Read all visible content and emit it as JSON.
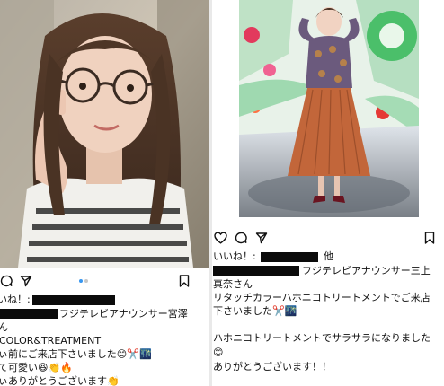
{
  "left_post": {
    "likes_prefix": "いね！:",
    "caption_line1": "フジテレビアナウンサー宮澤",
    "caption_line2": "ん",
    "caption_line3": "COLOR&TREATMENT",
    "caption_line4": "ぃ前にご来店下さいました😊✂️🌃",
    "caption_line5": "て可愛い😆👏🔥",
    "caption_line6": "ぃありがとうございます👏"
  },
  "right_post": {
    "likes_prefix": "いいね！:",
    "likes_suffix": "他",
    "caption_line1": "フジテレビアナウンサー三上",
    "caption_line2": "真奈さん",
    "caption_line3": "リタッチカラーハホニコトリートメントでご来店",
    "caption_line4": "下さいました✂️🌃",
    "caption_line5": "ハホニコトリートメントでサラサラになりました",
    "caption_line6": "😊",
    "caption_line7": "ありがとうございます！！"
  },
  "colors": {
    "like_active": "#111111",
    "carousel_dot_active": "#3897f0",
    "carousel_dot_inactive": "#c7c7c7",
    "redaction": "#0b0b0b"
  },
  "icons": {
    "left": [
      "comment-icon",
      "share-icon",
      "bookmark-icon"
    ],
    "right": [
      "heart-icon",
      "comment-icon",
      "share-icon",
      "bookmark-icon"
    ]
  }
}
